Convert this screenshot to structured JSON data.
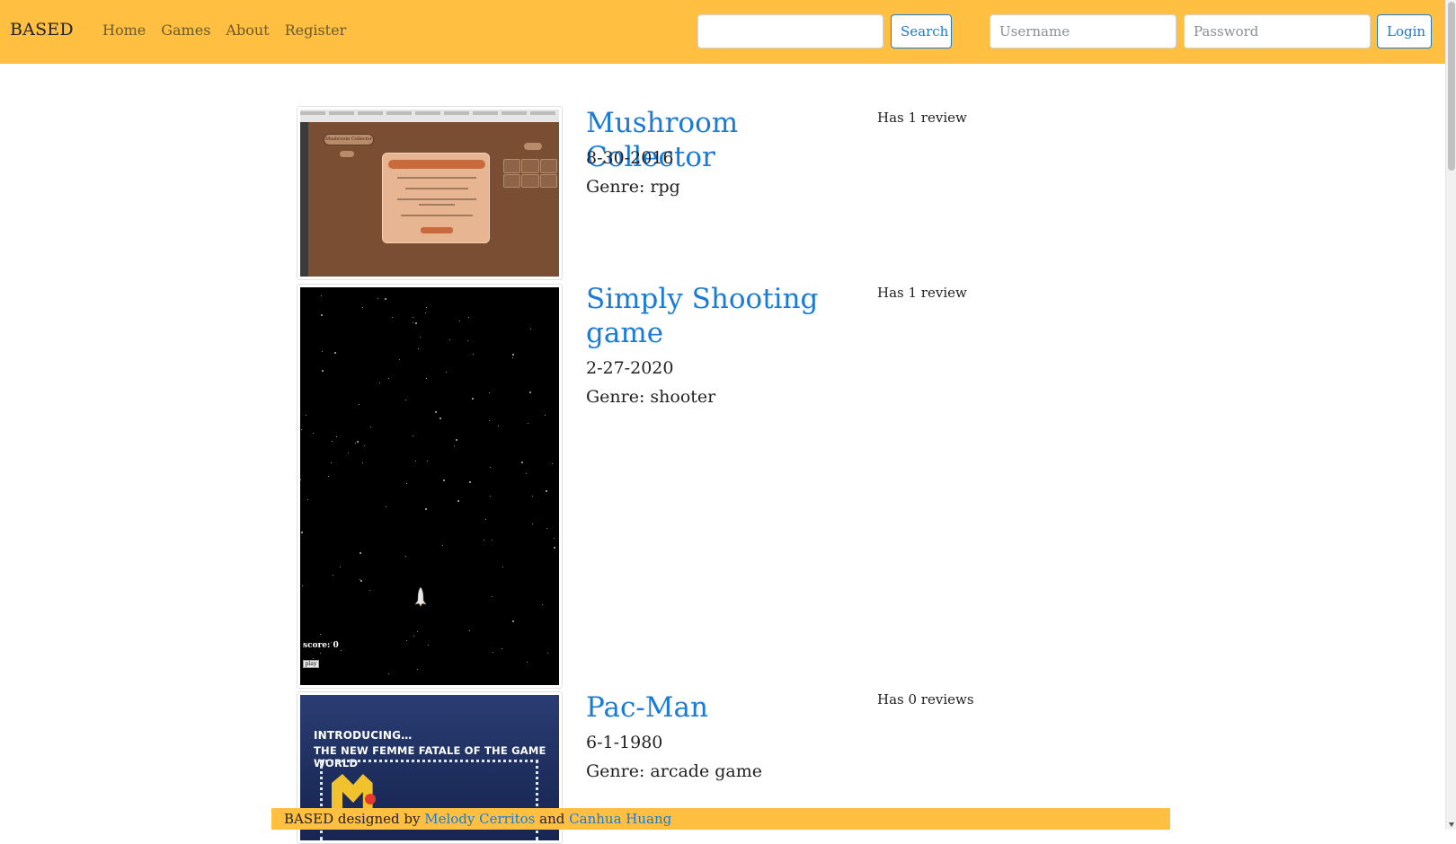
{
  "navbar": {
    "brand": "BASED",
    "links": [
      "Home",
      "Games",
      "About",
      "Register"
    ],
    "search": {
      "placeholder": "",
      "button": "Search"
    },
    "login": {
      "username_placeholder": "Username",
      "password_placeholder": "Password",
      "button": "Login"
    }
  },
  "games": [
    {
      "title": "Mushroom Collector",
      "date": "8-30-2016",
      "genre": "Genre: rpg",
      "reviews": "Has 1 review",
      "thumb": {
        "game_title": "Mushroom Collector"
      }
    },
    {
      "title": "Simply Shooting game",
      "date": "2-27-2020",
      "genre": "Genre: shooter",
      "reviews": "Has 1 review",
      "thumb": {
        "score": "score: 0",
        "play": "play"
      }
    },
    {
      "title": "Pac-Man",
      "date": "6-1-1980",
      "genre": "Genre: arcade game",
      "reviews": "Has 0 reviews",
      "thumb": {
        "line1": "INTRODUCING…",
        "line2": "THE NEW FEMME FATALE OF THE GAME WORLD"
      }
    }
  ],
  "footer": {
    "prefix": "BASED designed by",
    "author1": "Melody Cerritos",
    "and": "and",
    "author2": "Canhua Huang"
  },
  "colors": {
    "navbar_bg": "#ffbf40",
    "link_blue": "#1a7bd6"
  }
}
